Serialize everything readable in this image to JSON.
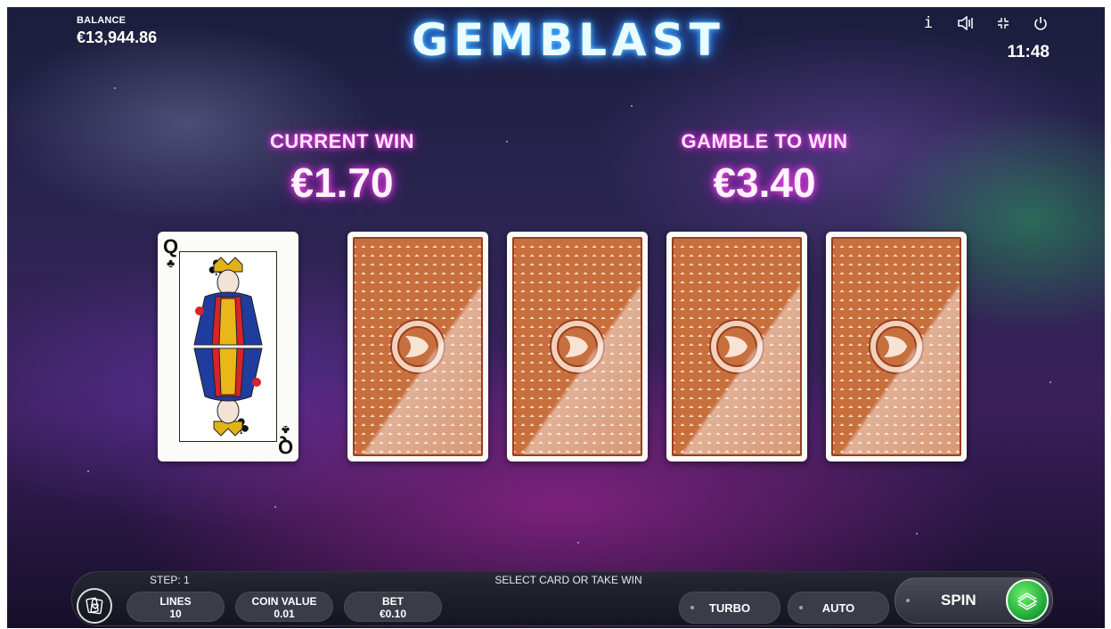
{
  "header": {
    "balance_label": "BALANCE",
    "balance_value": "€13,944.86",
    "logo": "GEMBLAST",
    "clock": "11:48",
    "icons": [
      "info-icon",
      "sound-icon",
      "fullscreen-icon",
      "power-icon"
    ],
    "info_glyph": "i"
  },
  "gamble": {
    "current_win_label": "CURRENT WIN",
    "current_win_value": "€1.70",
    "gamble_to_win_label": "GAMBLE TO WIN",
    "gamble_to_win_value": "€3.40"
  },
  "cards": {
    "dealer_card": {
      "rank": "Q",
      "suit": "♣",
      "face_up": true
    },
    "choice_cards": [
      "face-down",
      "face-down",
      "face-down",
      "face-down"
    ]
  },
  "bottom": {
    "step": "STEP: 1",
    "status": "SELECT CARD OR TAKE WIN",
    "lines_label": "LINES",
    "lines_value": "10",
    "coin_value_label": "COIN VALUE",
    "coin_value_value": "0.01",
    "bet_label": "BET",
    "bet_value": "€0.10",
    "turbo_label": "TURBO",
    "auto_label": "AUTO",
    "spin_label": "SPIN"
  },
  "colors": {
    "accent_magenta": "#ff3cf0",
    "logo_glow": "#2a8dff",
    "spin_green": "#1fa83a",
    "card_back": "#c86f3e"
  }
}
